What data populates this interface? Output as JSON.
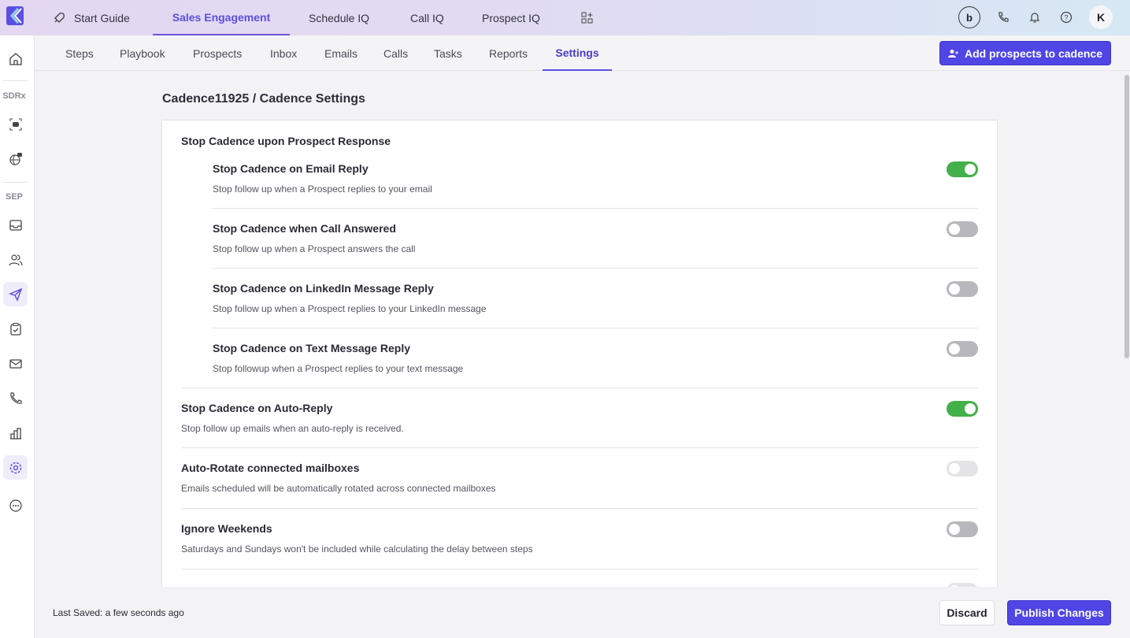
{
  "colors": {
    "accent": "#4f46e5",
    "toggle_on": "#44b04a",
    "toggle_off": "#b7b7bd"
  },
  "topnav": {
    "tabs": [
      {
        "label": "Start Guide",
        "icon": "rocket-icon"
      },
      {
        "label": "Sales Engagement",
        "active": true
      },
      {
        "label": "Schedule IQ"
      },
      {
        "label": "Call IQ"
      },
      {
        "label": "Prospect IQ"
      }
    ],
    "avatar": "K"
  },
  "sidebar": {
    "section_sdrx": "SDRx",
    "section_sep": "SEP",
    "active": "cadences",
    "icons": [
      "home-icon",
      "bot-icon",
      "globe-bot-icon",
      "inbox-icon",
      "users-icon",
      "send-icon",
      "clipboard-check-icon",
      "mail-icon",
      "phone-icon",
      "chart-icon",
      "settings-icon",
      "more-icon"
    ]
  },
  "subnav": {
    "tabs": [
      "Steps",
      "Playbook",
      "Prospects",
      "Inbox",
      "Emails",
      "Calls",
      "Tasks",
      "Reports",
      "Settings"
    ],
    "active": "Settings",
    "add_button": "Add prospects to cadence"
  },
  "breadcrumb": "Cadence11925 / Cadence Settings",
  "settings": {
    "section_title": "Stop Cadence upon Prospect Response",
    "nested": [
      {
        "title": "Stop Cadence on Email Reply",
        "desc": "Stop follow up when a Prospect replies to your email",
        "on": true
      },
      {
        "title": "Stop Cadence when Call Answered",
        "desc": "Stop follow up when a Prospect answers the call",
        "on": false
      },
      {
        "title": "Stop Cadence on LinkedIn Message Reply",
        "desc": "Stop follow up when a Prospect replies to your LinkedIn message",
        "on": false
      },
      {
        "title": "Stop Cadence on Text Message Reply",
        "desc": "Stop followup when a Prospect replies to your text message",
        "on": false
      }
    ],
    "rows": [
      {
        "title": "Stop Cadence on Auto-Reply",
        "desc": "Stop follow up emails when an auto-reply is received.",
        "on": true
      },
      {
        "title": "Auto-Rotate connected mailboxes",
        "desc": "Emails scheduled will be automatically rotated across connected mailboxes",
        "on": false,
        "disabled": true
      },
      {
        "title": "Ignore Weekends",
        "desc": "Saturdays and Sundays won't be included while calculating the delay between steps",
        "on": false
      }
    ]
  },
  "footer": {
    "last_saved": "Last Saved: a few seconds ago",
    "discard": "Discard",
    "publish": "Publish Changes"
  }
}
